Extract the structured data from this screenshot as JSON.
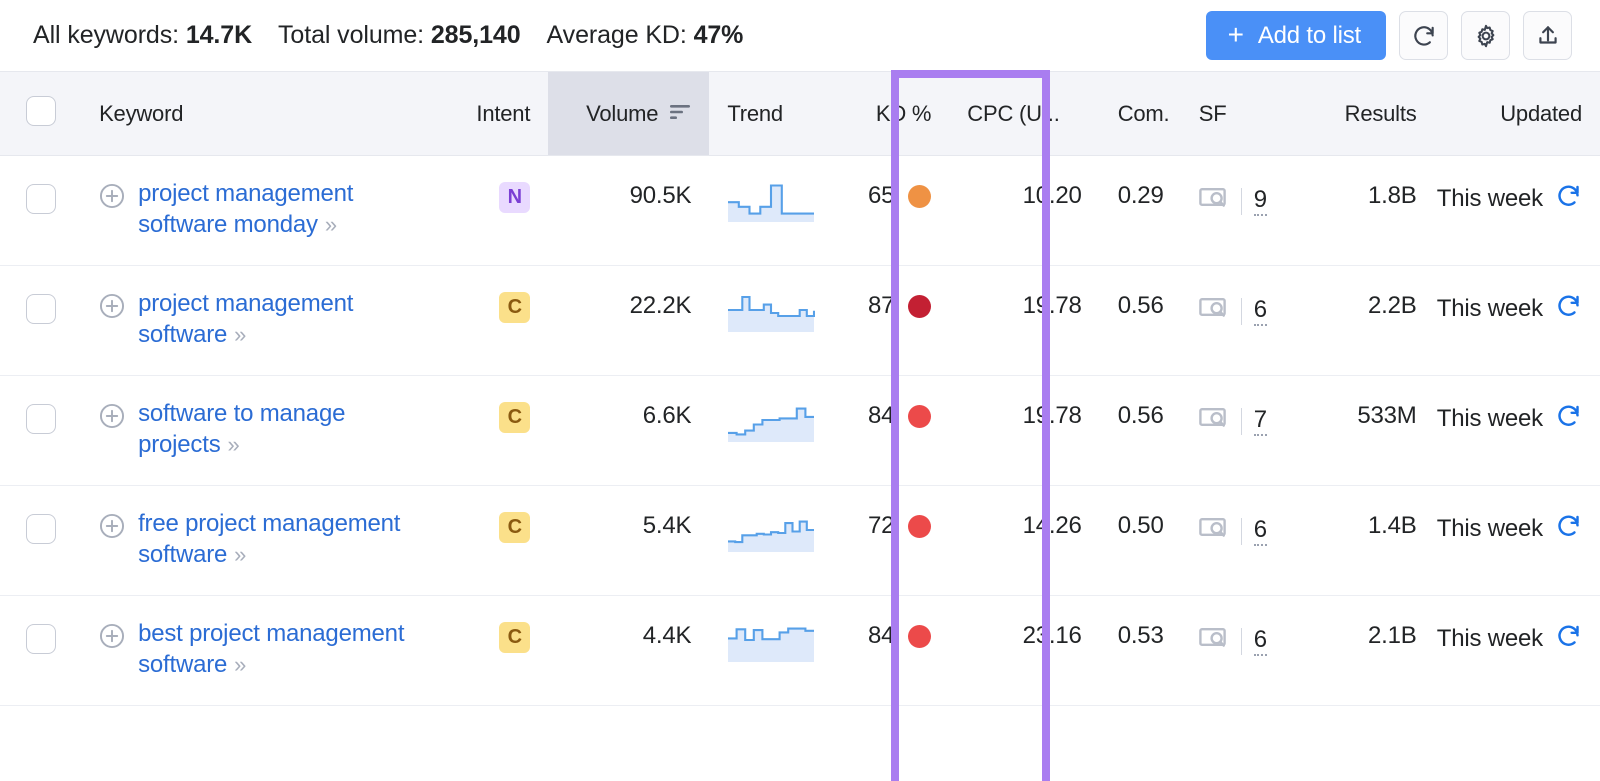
{
  "summary": [
    {
      "label": "All keywords: ",
      "value": "14.7K"
    },
    {
      "label": "Total volume: ",
      "value": "285,140"
    },
    {
      "label": "Average KD: ",
      "value": "47%"
    }
  ],
  "toolbar": {
    "add_to_list_label": "Add to list",
    "add_plus": "+",
    "refresh_icon": "refresh-icon",
    "settings_icon": "gear-icon",
    "export_icon": "export-icon",
    "accent_color": "#4a90f7"
  },
  "table": {
    "columns": [
      {
        "key": "check",
        "label": ""
      },
      {
        "key": "keyword",
        "label": "Keyword"
      },
      {
        "key": "intent",
        "label": "Intent"
      },
      {
        "key": "volume",
        "label": "Volume"
      },
      {
        "key": "trend",
        "label": "Trend"
      },
      {
        "key": "kd",
        "label": "KD %"
      },
      {
        "key": "cpc",
        "label": "CPC (U..."
      },
      {
        "key": "com",
        "label": "Com."
      },
      {
        "key": "sf",
        "label": "SF"
      },
      {
        "key": "results",
        "label": "Results"
      },
      {
        "key": "updated",
        "label": "Updated"
      }
    ],
    "sorted_column": "volume",
    "highlighted_column": "cpc",
    "highlight_color": "#a97df0",
    "rows": [
      {
        "keyword": "project management software monday",
        "chevron": "»",
        "intent": "N",
        "intent_type": "navigational",
        "volume": "90.5K",
        "trend": [
          52,
          40,
          22,
          40,
          96,
          22,
          22,
          22,
          22
        ],
        "kd": "65",
        "kd_color": "#ef9244",
        "cpc": "10.20",
        "com": "0.29",
        "sf": "9",
        "results": "1.8B",
        "updated": "This week"
      },
      {
        "keyword": "project management software",
        "chevron": "»",
        "intent": "C",
        "intent_type": "commercial",
        "volume": "22.2K",
        "trend": [
          58,
          58,
          92,
          58,
          58,
          72,
          50,
          42,
          42,
          42,
          58,
          42,
          56
        ],
        "kd": "87",
        "kd_color": "#c32033",
        "cpc": "19.78",
        "com": "0.56",
        "sf": "6",
        "results": "2.2B",
        "updated": "This week"
      },
      {
        "keyword": "software to manage projects",
        "chevron": "»",
        "intent": "C",
        "intent_type": "commercial",
        "volume": "6.6K",
        "trend": [
          24,
          20,
          30,
          46,
          58,
          58,
          62,
          62,
          88,
          66,
          66
        ],
        "kd": "84",
        "kd_color": "#ec4a4a",
        "cpc": "19.78",
        "com": "0.56",
        "sf": "7",
        "results": "533M",
        "updated": "This week"
      },
      {
        "keyword": "free project management software",
        "chevron": "»",
        "intent": "C",
        "intent_type": "commercial",
        "volume": "5.4K",
        "trend": [
          28,
          26,
          44,
          44,
          48,
          46,
          52,
          50,
          76,
          54,
          80,
          58,
          58
        ],
        "kd": "72",
        "kd_color": "#ec4a4a",
        "cpc": "14.26",
        "com": "0.50",
        "sf": "6",
        "results": "1.4B",
        "updated": "This week"
      },
      {
        "keyword": "best project management software",
        "chevron": "»",
        "intent": "C",
        "intent_type": "commercial",
        "volume": "4.4K",
        "trend": [
          62,
          86,
          58,
          84,
          60,
          60,
          78,
          88,
          88,
          82,
          82
        ],
        "kd": "84",
        "kd_color": "#ec4a4a",
        "cpc": "23.16",
        "com": "0.53",
        "sf": "6",
        "results": "2.1B",
        "updated": "This week"
      }
    ]
  }
}
